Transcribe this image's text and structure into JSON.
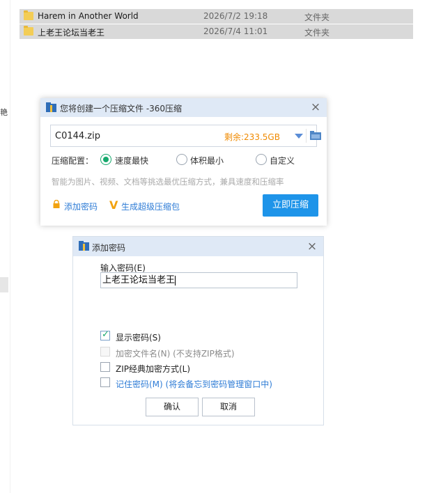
{
  "explorer": {
    "left_text": "艳",
    "files": [
      {
        "name": "Harem in Another World",
        "date": "2026/7/2 19:18",
        "type": "文件夹"
      },
      {
        "name": "上老王论坛当老王",
        "date": "2026/7/4 11:01",
        "type": "文件夹"
      }
    ]
  },
  "compress_dialog": {
    "title": "您将创建一个压缩文件 -360压缩",
    "close_icon": "×",
    "file_name": "C0144.zip",
    "free_space": "剩余:233.5GB",
    "config_label": "压缩配置：",
    "options": [
      {
        "label": "速度最快",
        "selected": true
      },
      {
        "label": "体积最小",
        "selected": false
      },
      {
        "label": "自定义",
        "selected": false
      }
    ],
    "hint": "智能为图片、视频、文档等挑选最优压缩方式，兼具速度和压缩率",
    "add_password_link": "添加密码",
    "super_pack_link": "生成超级压缩包",
    "super_pack_icon": "V",
    "compress_button": "立即压缩",
    "colors": {
      "accent": "#1e94e9",
      "space": "#f08a00",
      "radio": "#15a86c",
      "link": "#2e7cd6"
    }
  },
  "password_dialog": {
    "title": "添加密码",
    "close_icon": "×",
    "input_label": "输入密码(E)",
    "password_value": "上老王论坛当老王",
    "checkmark": "✓",
    "checkboxes": [
      {
        "label": "显示密码(S)",
        "checked": true,
        "disabled": false
      },
      {
        "label": "加密文件名(N) (不支持ZIP格式)",
        "checked": false,
        "disabled": true
      },
      {
        "label": "ZIP经典加密方式(L)",
        "checked": false,
        "disabled": false
      },
      {
        "label": "记住密码(M) (将会备忘到密码管理窗口中)",
        "checked": false,
        "disabled": false
      }
    ],
    "ok_button": "确认",
    "cancel_button": "取消"
  }
}
